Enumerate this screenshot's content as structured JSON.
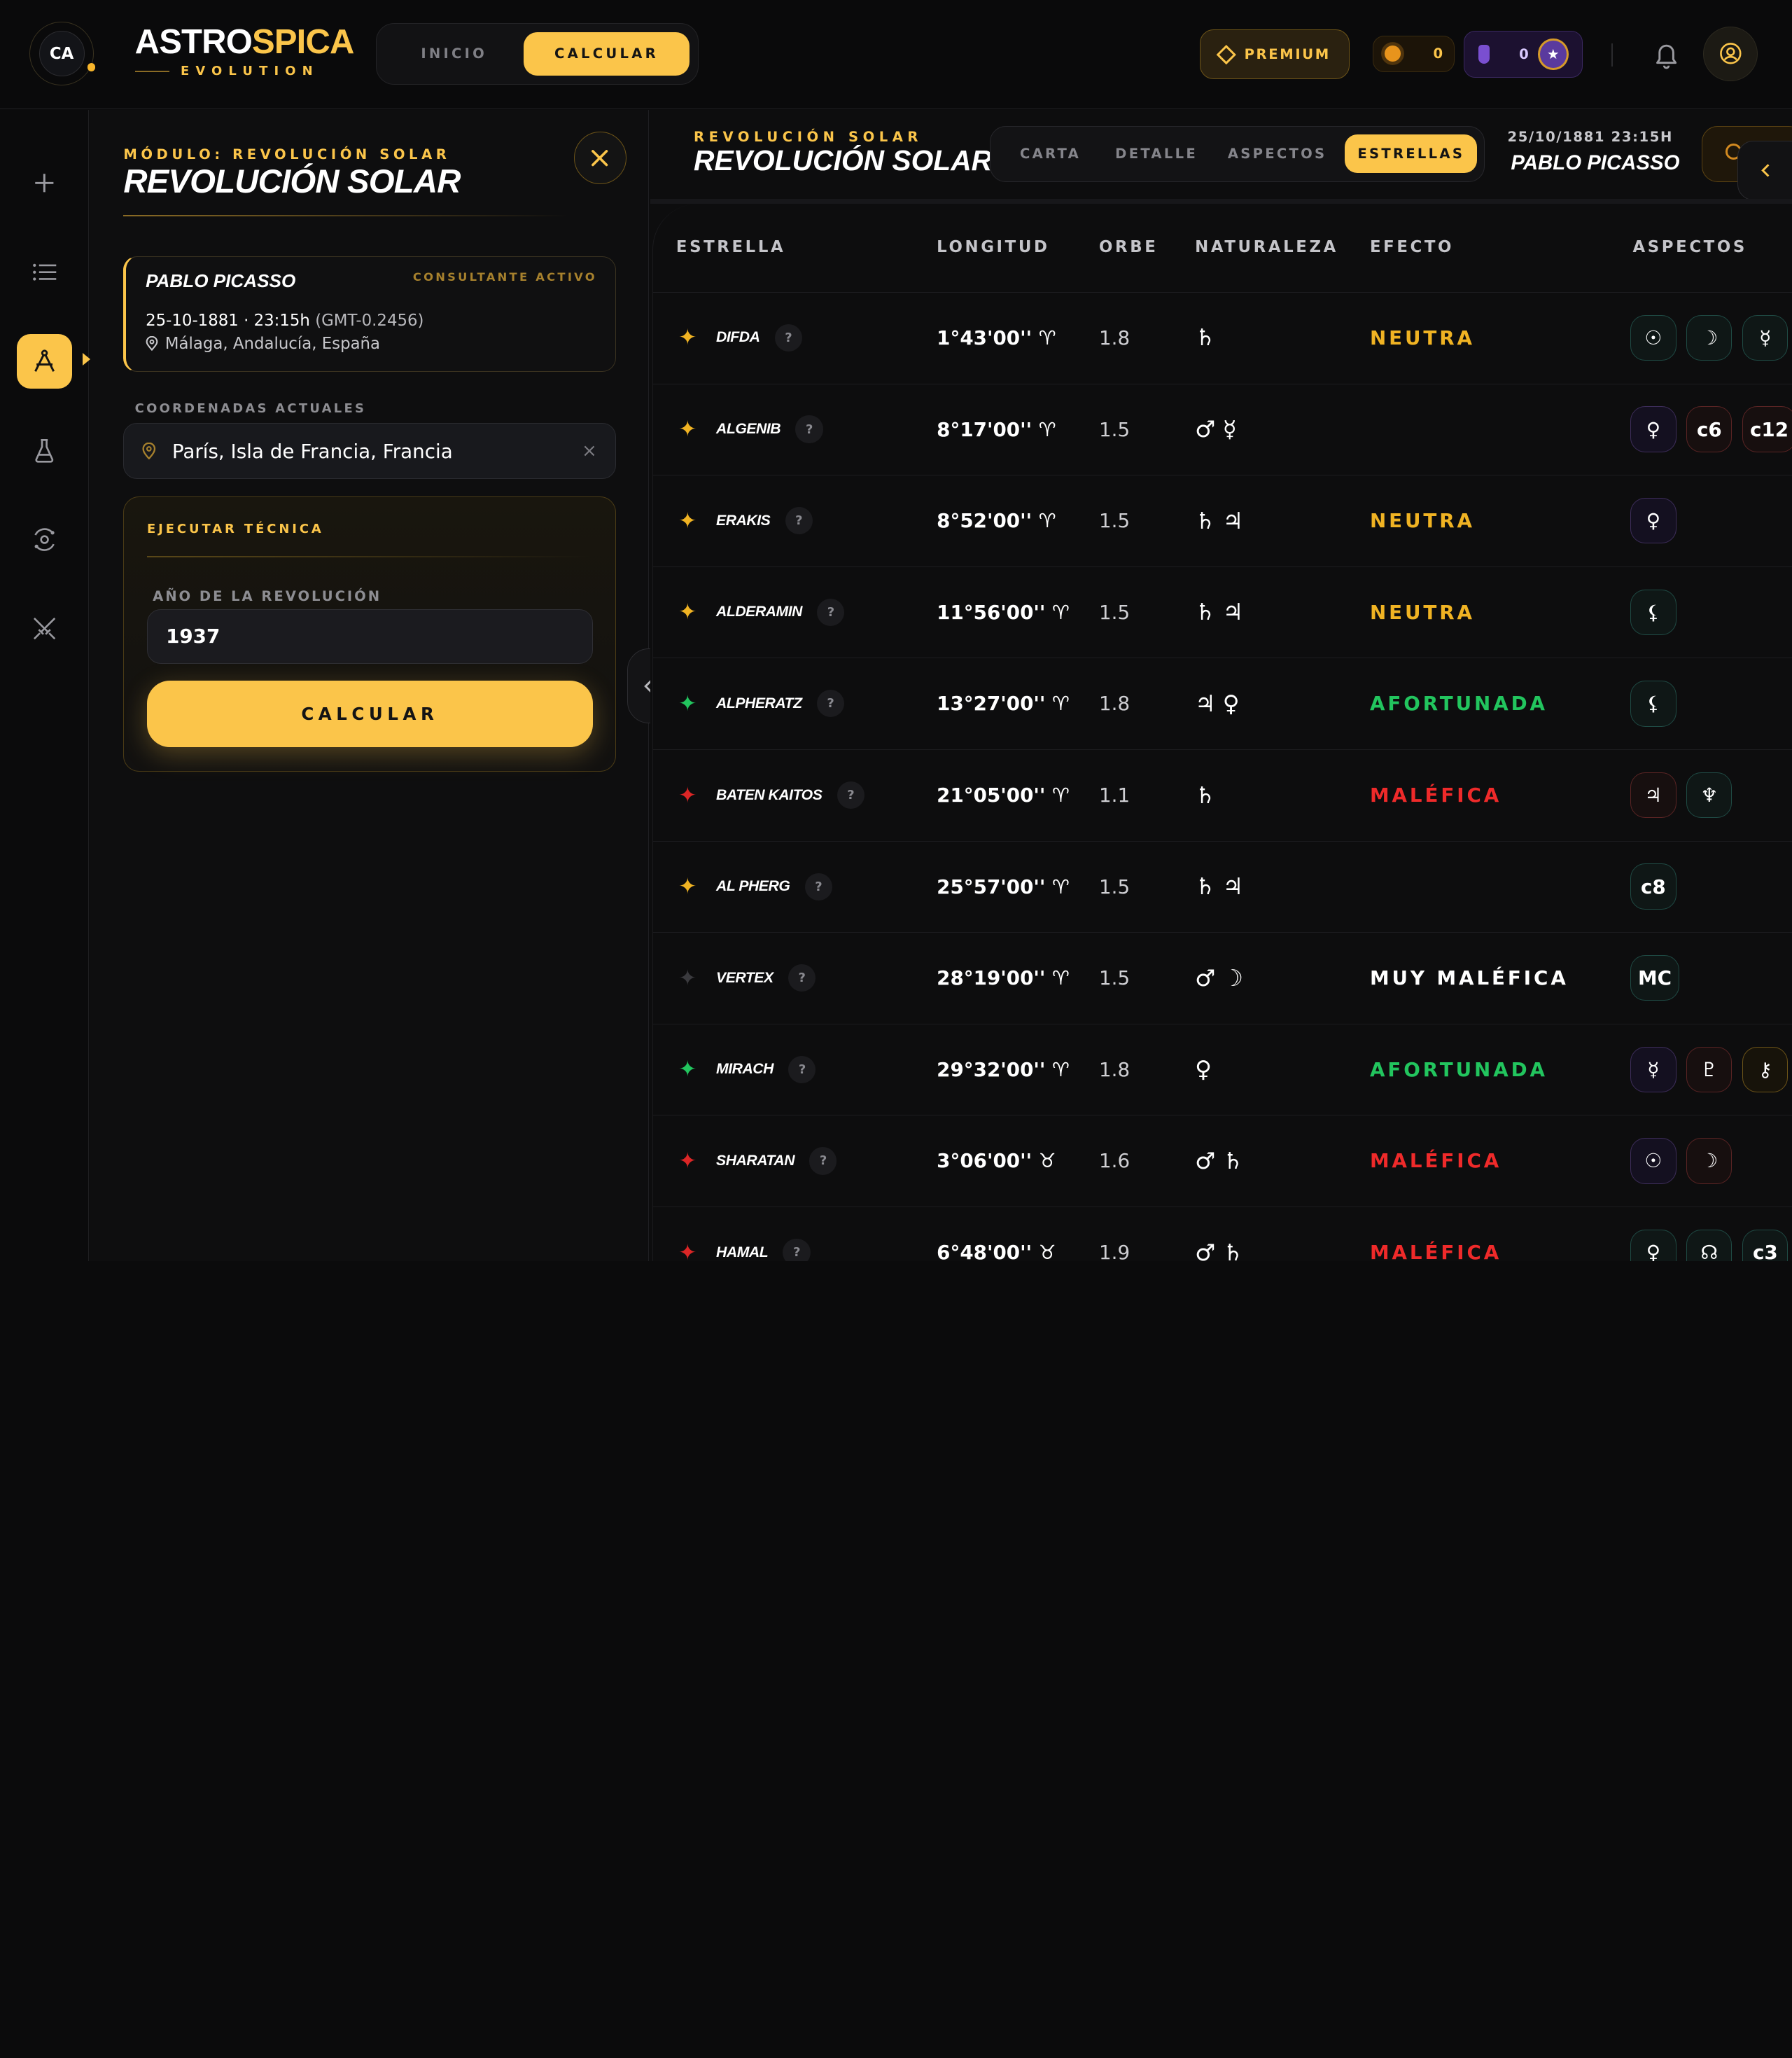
{
  "header": {
    "avatar_initials": "CA",
    "logo_part1": "ASTRO",
    "logo_part2": "SPICA",
    "logo_sub": "EVOLUTION",
    "nav": [
      "INICIO",
      "CALCULAR"
    ],
    "nav_active": "CALCULAR",
    "premium_label": "PREMIUM",
    "sun_count": "0",
    "potion_count": "0",
    "star_badge": "★"
  },
  "sidebar": {
    "items": [
      "plus-icon",
      "list-icon",
      "compass-icon",
      "flask-icon",
      "orbit-icon",
      "swords-icon"
    ],
    "active": "compass-icon"
  },
  "panel": {
    "kicker": "MÓDULO: REVOLUCIÓN SOLAR",
    "title": "REVOLUCIÓN SOLAR",
    "consultant": {
      "name": "PABLO PICASSO",
      "tag": "CONSULTANTE ACTIVO",
      "date": "25-10-1881 · 23:15h",
      "gmt": "(GMT-0.2456)",
      "place": "Málaga, Andalucía, España"
    },
    "coords_label": "COORDENADAS ACTUALES",
    "coords_value": "París, Isla de Francia, Francia",
    "exec_title": "EJECUTAR TÉCNICA",
    "year_label": "AÑO DE LA REVOLUCIÓN",
    "year_value": "1937",
    "calc_label": "CALCULAR"
  },
  "main": {
    "kicker": "REVOLUCIÓN SOLAR",
    "title": "REVOLUCIÓN SOLAR",
    "tabs": [
      "CARTA",
      "DETALLE",
      "ASPECTOS",
      "ESTRELLAS"
    ],
    "active_tab": "ESTRELLAS",
    "date": "25/10/1881 23:15H",
    "name": "PABLO PICASSO"
  },
  "table": {
    "headers": [
      "ESTRELLA",
      "LONGITUD",
      "ORBE",
      "NATURALEZA",
      "EFECTO",
      "ASPECTOS"
    ],
    "rows": [
      {
        "star": "DIFDA",
        "lon": "1°43'00'' ♈︎",
        "orb": "1.8",
        "nat": "♄",
        "effect": "NEUTRA",
        "color": "#f0b323",
        "aspects": [
          {
            "s": "☉",
            "c": "teal"
          },
          {
            "s": "☽",
            "c": "teal"
          },
          {
            "s": "☿",
            "c": "teal"
          }
        ]
      },
      {
        "star": "ALGENIB",
        "lon": "8°17'00'' ♈︎",
        "orb": "1.5",
        "nat": "♂ ☿",
        "effect": "",
        "color": "#f0b323",
        "aspects": [
          {
            "s": "♀",
            "c": "purple"
          },
          {
            "s": "c6",
            "c": "red"
          },
          {
            "s": "c12",
            "c": "red"
          }
        ]
      },
      {
        "star": "ERAKIS",
        "lon": "8°52'00'' ♈︎",
        "orb": "1.5",
        "nat": "♄ ♃",
        "effect": "NEUTRA",
        "color": "#f0b323",
        "aspects": [
          {
            "s": "♀",
            "c": "purple"
          }
        ]
      },
      {
        "star": "ALDERAMIN",
        "lon": "11°56'00'' ♈︎",
        "orb": "1.5",
        "nat": "♄ ♃",
        "effect": "NEUTRA",
        "color": "#f0b323",
        "aspects": [
          {
            "s": "⚸",
            "c": "teal"
          }
        ]
      },
      {
        "star": "ALPHERATZ",
        "lon": "13°27'00'' ♈︎",
        "orb": "1.8",
        "nat": "♃ ♀",
        "effect": "AFORTUNADA",
        "color": "#22c55e",
        "aspects": [
          {
            "s": "⚸",
            "c": "teal"
          }
        ]
      },
      {
        "star": "BATEN KAITOS",
        "lon": "21°05'00'' ♈︎",
        "orb": "1.1",
        "nat": "♄",
        "effect": "MALÉFICA",
        "color": "#ef2a2a",
        "aspects": [
          {
            "s": "♃",
            "c": "red"
          },
          {
            "s": "♆",
            "c": "teal"
          }
        ]
      },
      {
        "star": "AL PHERG",
        "lon": "25°57'00'' ♈︎",
        "orb": "1.5",
        "nat": "♄ ♃",
        "effect": "",
        "color": "#f0b323",
        "aspects": [
          {
            "s": "c8",
            "c": "teal"
          }
        ]
      },
      {
        "star": "VERTEX",
        "lon": "28°19'00'' ♈︎",
        "orb": "1.5",
        "nat": "♂ ☽",
        "effect": "MUY MALÉFICA",
        "color": "#ffffff",
        "aspects": [
          {
            "s": "MC",
            "c": "teal"
          }
        ]
      },
      {
        "star": "MIRACH",
        "lon": "29°32'00'' ♈︎",
        "orb": "1.8",
        "nat": "♀",
        "effect": "AFORTUNADA",
        "color": "#22c55e",
        "aspects": [
          {
            "s": "☿",
            "c": "purple"
          },
          {
            "s": "♇",
            "c": "red"
          },
          {
            "s": "⚷",
            "c": "gold"
          }
        ]
      },
      {
        "star": "SHARATAN",
        "lon": "3°06'00'' ♉︎",
        "orb": "1.6",
        "nat": "♂ ♄",
        "effect": "MALÉFICA",
        "color": "#ef2a2a",
        "aspects": [
          {
            "s": "☉",
            "c": "purple"
          },
          {
            "s": "☽",
            "c": "red"
          }
        ]
      },
      {
        "star": "HAMAL",
        "lon": "6°48'00'' ♉︎",
        "orb": "1.9",
        "nat": "♂ ♄",
        "effect": "MALÉFICA",
        "color": "#ef2a2a",
        "aspects": [
          {
            "s": "♀",
            "c": "teal"
          },
          {
            "s": "☊",
            "c": "teal"
          },
          {
            "s": "c3",
            "c": "teal"
          }
        ]
      }
    ],
    "star_icon_colors": [
      "#f0b323",
      "#f0b323",
      "#f0b323",
      "#f0b323",
      "#22c55e",
      "#dc2626",
      "#f0b323",
      "#3a3a3e",
      "#22c55e",
      "#dc2626",
      "#dc2626"
    ]
  }
}
